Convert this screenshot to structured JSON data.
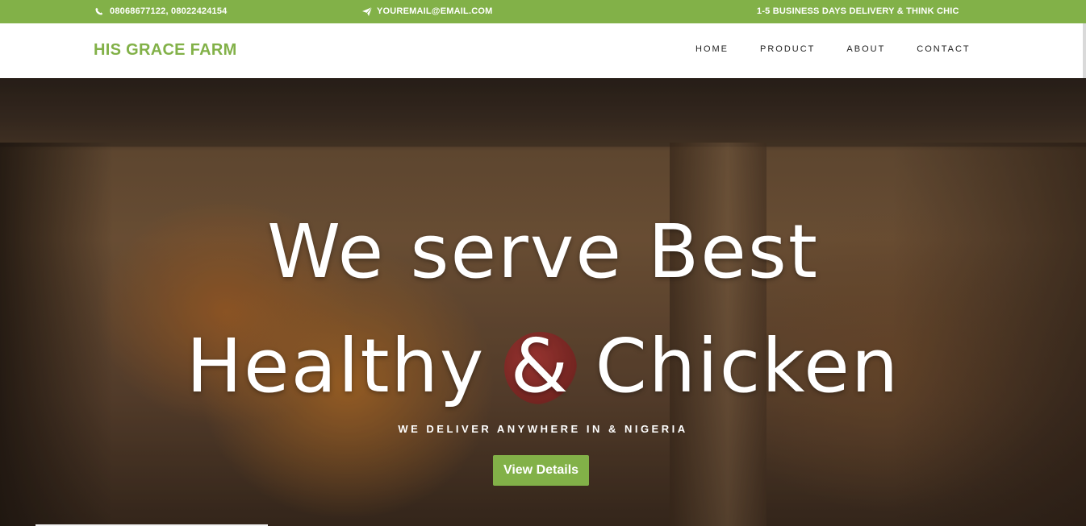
{
  "topbar": {
    "phone": "08068677122, 08022424154",
    "email": "YOUREMAIL@EMAIL.COM",
    "delivery": "1-5 BUSINESS DAYS DELIVERY & THINK CHIC",
    "phone_icon": "phone-icon",
    "email_icon": "paper-plane-icon"
  },
  "header": {
    "brand": "HIS GRACE FARM",
    "nav": [
      "HOME",
      "PRODUCT",
      "ABOUT",
      "CONTACT"
    ]
  },
  "hero": {
    "title_line1": "We serve Best",
    "title_line2": "Healthy & Chicken",
    "subtitle": "WE DELIVER ANYWHERE IN & NIGERIA",
    "button": "View Details"
  },
  "colors": {
    "accent": "#82b148",
    "white": "#ffffff"
  }
}
